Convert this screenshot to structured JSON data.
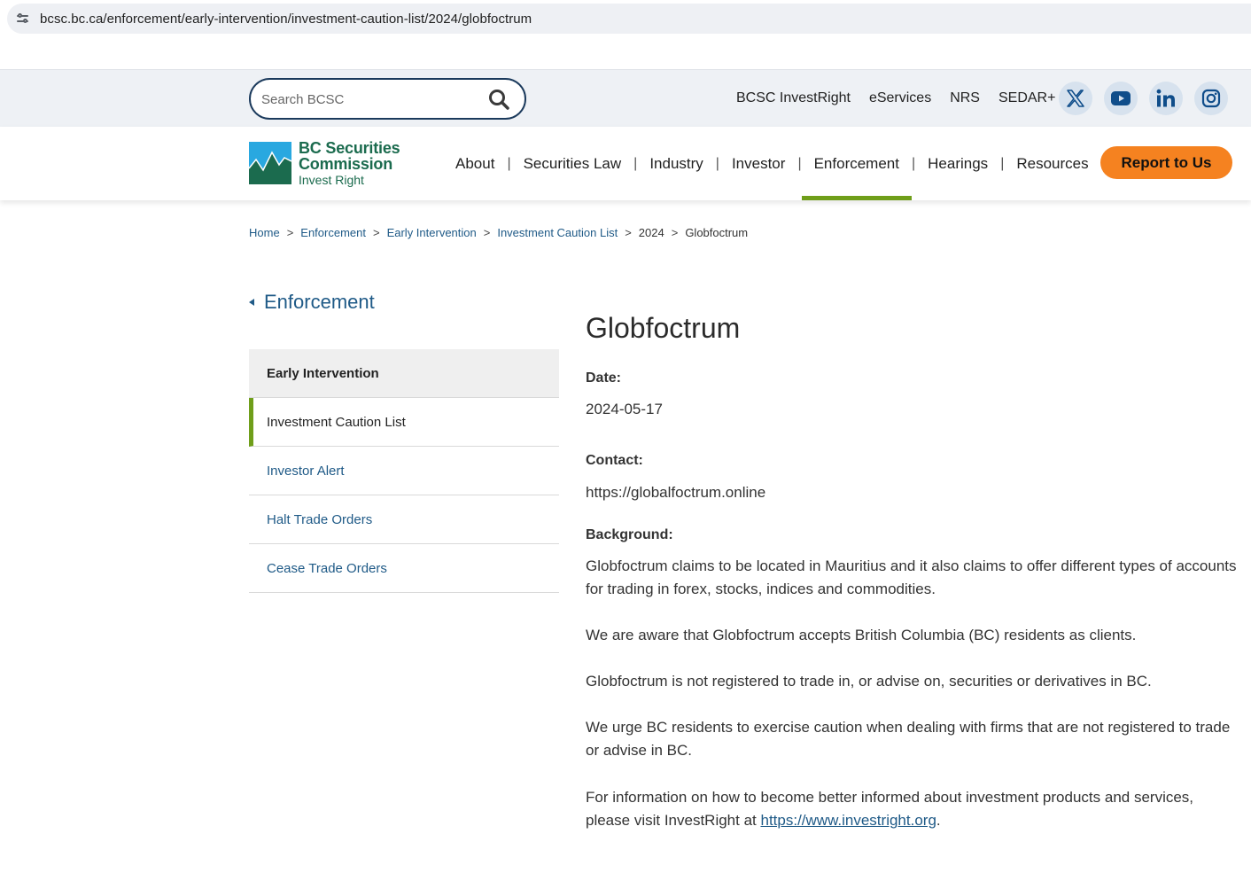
{
  "browser": {
    "url": "bcsc.bc.ca/enforcement/early-intervention/investment-caution-list/2024/globfoctrum"
  },
  "utility": {
    "search_placeholder": "Search BCSC",
    "links": [
      "BCSC InvestRight",
      "eServices",
      "NRS",
      "SEDAR+"
    ],
    "social_icons": [
      "x-icon",
      "youtube-icon",
      "linkedin-icon",
      "instagram-icon"
    ]
  },
  "brand": {
    "line1": "BC Securities",
    "line2": "Commission",
    "tagline": "Invest Right",
    "color": "#1b6b4e"
  },
  "nav": {
    "items": [
      "About",
      "Securities Law",
      "Industry",
      "Investor",
      "Enforcement",
      "Hearings",
      "Resources"
    ],
    "active": "Enforcement",
    "report_label": "Report to Us",
    "accent": "#6f9e1a",
    "report_color": "#f58220"
  },
  "breadcrumb": {
    "items": [
      "Home",
      "Enforcement",
      "Early Intervention",
      "Investment Caution List",
      "2024",
      "Globfoctrum"
    ]
  },
  "sidebar": {
    "back_label": "Enforcement",
    "header": "Early Intervention",
    "items": [
      "Investment Caution List",
      "Investor Alert",
      "Halt Trade Orders",
      "Cease Trade Orders"
    ],
    "current": "Investment Caution List"
  },
  "article": {
    "title": "Globfoctrum",
    "date_label": "Date:",
    "date": "2024-05-17",
    "contact_label": "Contact:",
    "contact": "https://globalfoctrum.online",
    "background_label": "Background:",
    "paragraphs": [
      "Globfoctrum claims to be located in Mauritius and it also claims to offer different types of accounts for trading in forex, stocks, indices and commodities.",
      "We are aware that Globfoctrum accepts British Columbia (BC) residents as clients.",
      "Globfoctrum is not registered to trade in, or advise on, securities or derivatives in BC.",
      "We urge BC residents to exercise caution when dealing with firms that are not registered to trade or advise in BC."
    ],
    "last_paragraph_prefix": "For information on how to become better informed about investment products and services, please visit InvestRight at ",
    "last_paragraph_link": "https://www.investright.org",
    "last_paragraph_suffix": "."
  }
}
